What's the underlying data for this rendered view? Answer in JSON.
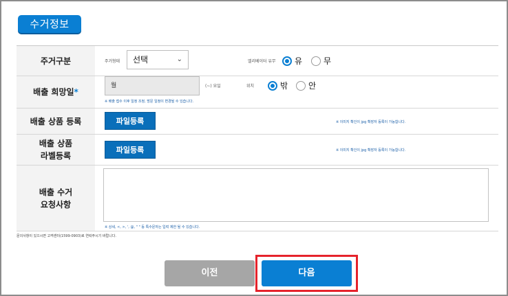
{
  "section_title": "수거정보",
  "rows": {
    "type": {
      "label": "주거구분",
      "sub_label": "주거형태",
      "select_value": "선택",
      "elevator_label": "엘리베이터 유무",
      "radio_yes": "유",
      "radio_no": "무"
    },
    "date": {
      "label": "배출 희망일",
      "required_mark": "*",
      "input_value": "월",
      "suffix": "(~) 요일",
      "location_label": "위치",
      "radio_out": "밖",
      "radio_in": "안",
      "note": "※ 배출 접수 이후 일정 조정, 방문 일정이 변경될 수 있습니다."
    },
    "product": {
      "label": "배출 상품 등록",
      "button": "파일등록",
      "note": "※ 이미지 확인이 jpg 확장자 등록이 가능합니다."
    },
    "label_reg": {
      "label_line1": "배출 상품",
      "label_line2": "라벨등록",
      "button": "파일등록",
      "note": "※ 이미지 확인이 jpg 확장자 등록이 가능합니다."
    },
    "request": {
      "label_line1": "배출 수거",
      "label_line2": "요청사항",
      "note": "※ 상세, <, >, ', @, \"  \" 등 특수문자는 입력 제한 될 수 있습니다."
    }
  },
  "footnote": "문의사항이 있으시면 고객센터(1599-0903)로 연락주시기 바랍니다.",
  "buttons": {
    "prev": "이전",
    "next": "다음"
  },
  "colors": {
    "accent": "#0a7fd3",
    "highlight": "#e5222b",
    "disabled": "#a6a6a6"
  }
}
